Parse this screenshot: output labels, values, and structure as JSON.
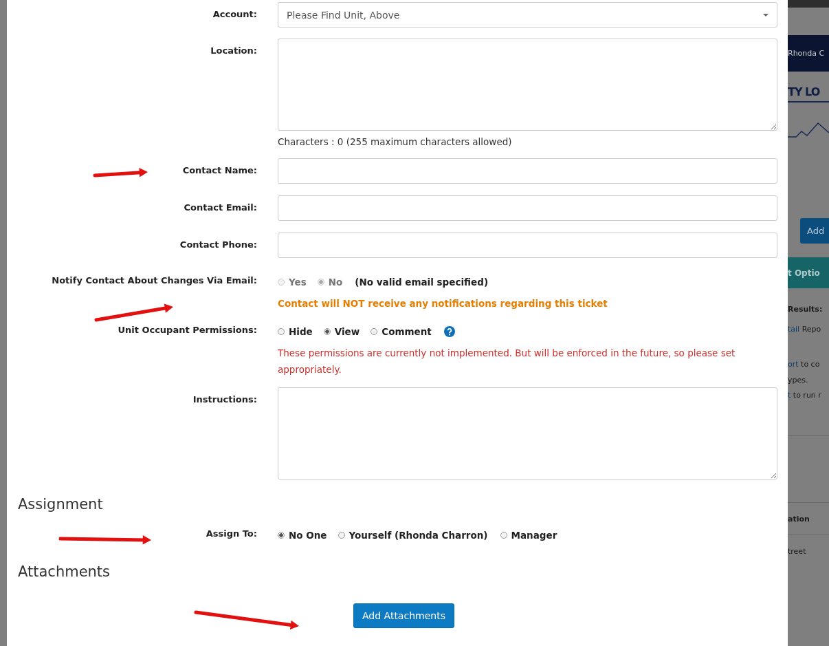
{
  "form": {
    "rows": [
      {
        "kind": "select",
        "label": "Account:",
        "value": "Please Find Unit, Above"
      },
      {
        "kind": "textarea",
        "label": "Location:",
        "help": "Characters : 0 (255 maximum characters allowed)"
      },
      {
        "kind": "input",
        "label": "Contact Name:"
      },
      {
        "kind": "input",
        "label": "Contact Email:"
      },
      {
        "kind": "input",
        "label": "Contact Phone:"
      },
      {
        "kind": "radios",
        "label": "Notify Contact About Changes Via Email:",
        "disabled": true,
        "options": [
          {
            "label": "Yes",
            "selected": false
          },
          {
            "label": "No",
            "selected": true
          }
        ],
        "note": "(No valid email specified)",
        "message": {
          "text": "Contact will NOT receive any notifications regarding this ticket",
          "kind": "warning"
        }
      },
      {
        "kind": "radios",
        "label": "Unit Occupant Permissions:",
        "disabled": false,
        "options": [
          {
            "label": "Hide",
            "selected": false
          },
          {
            "label": "View",
            "selected": true
          },
          {
            "label": "Comment",
            "selected": false
          }
        ],
        "help_icon": true,
        "message": {
          "text": "These permissions are currently not implemented. But will be enforced in the future, so please set appropriately.",
          "kind": "error"
        }
      },
      {
        "kind": "textarea",
        "label": "Instructions:"
      }
    ]
  },
  "assignment": {
    "heading": "Assignment",
    "label": "Assign To:",
    "options": [
      {
        "label": "No One",
        "selected": true
      },
      {
        "label": "Yourself (Rhonda Charron)",
        "selected": false
      },
      {
        "label": "Manager",
        "selected": false
      }
    ]
  },
  "attachments": {
    "heading": "Attachments",
    "button": "Add Attachments"
  },
  "background": {
    "lines": [
      {
        "kind": "nav",
        "parts": [
          {
            "text": "Rhonda C",
            "link": false
          }
        ]
      },
      {
        "kind": "logo",
        "parts": [
          {
            "text": "TY LO",
            "link": false
          }
        ]
      },
      {
        "kind": "chart"
      },
      {
        "kind": "button",
        "parts": [
          {
            "text": "Add",
            "link": false
          }
        ]
      },
      {
        "kind": "banner",
        "parts": [
          {
            "text": "t Optio",
            "link": false
          }
        ]
      },
      {
        "kind": "bold",
        "parts": [
          {
            "text": "Results:",
            "link": false
          }
        ]
      },
      {
        "kind": "text",
        "parts": [
          {
            "text": "tail",
            "link": true
          },
          {
            "text": " Repo",
            "link": false
          }
        ]
      },
      {
        "kind": "text",
        "parts": [
          {
            "text": "ort",
            "link": true
          },
          {
            "text": " to co",
            "link": false
          }
        ]
      },
      {
        "kind": "text",
        "parts": [
          {
            "text": "ypes.",
            "link": false
          }
        ]
      },
      {
        "kind": "text",
        "parts": [
          {
            "text": "t",
            "link": true
          },
          {
            "text": " to run r",
            "link": false
          }
        ]
      },
      {
        "kind": "header",
        "parts": [
          {
            "text": "ation",
            "link": false
          }
        ]
      },
      {
        "kind": "cell",
        "parts": [
          {
            "text": "treet",
            "link": false
          }
        ]
      }
    ]
  }
}
